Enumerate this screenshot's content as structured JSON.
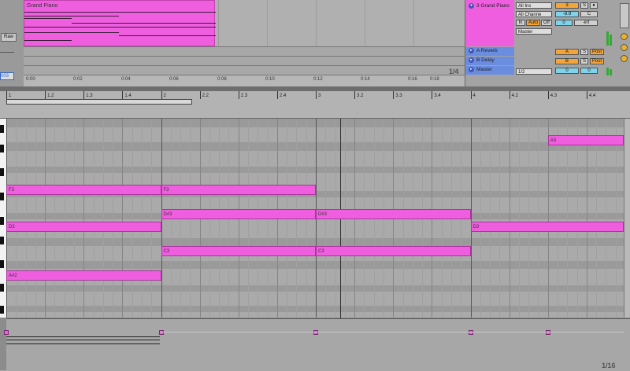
{
  "left_panel": {
    "raw_label": "Raw",
    "bottom_value": "003"
  },
  "arrangement": {
    "clip_name": "Grand Piano",
    "time_labels": [
      "0:00",
      "0:02",
      "0:04",
      "0:06",
      "0:08",
      "0:10",
      "0:12",
      "0:14",
      "0:16",
      "0:18"
    ],
    "zoom_label": "1/4"
  },
  "mixer": {
    "tracks": [
      {
        "name": "3 Grand Piano",
        "input": "All Ins",
        "channel": "All Channe",
        "monitor": [
          "In",
          "Auto",
          "Off"
        ],
        "output": "Master",
        "track_number": "3",
        "solo": "S",
        "volume": "-8.9",
        "pan": "C",
        "send_a": "0",
        "send_b": "-inf"
      },
      {
        "name": "A Reverb",
        "track_number": "A",
        "solo": "S",
        "post": "Post"
      },
      {
        "name": "B Delay",
        "track_number": "B",
        "solo": "S",
        "post": "Post"
      },
      {
        "name": "Master",
        "output": "1/2",
        "track_number": "0",
        "solo": "0"
      }
    ],
    "colors": {
      "clip": "#f05ee0",
      "return": "#6b8de0",
      "orange": "#f3a53a",
      "cyan": "#7fd3ea"
    }
  },
  "midi_editor": {
    "ruler_labels": [
      "1",
      "1.2",
      "1.3",
      "1.4",
      "2",
      "2.2",
      "2.3",
      "2.4",
      "3",
      "3.2",
      "3.3",
      "3.4",
      "4",
      "4.2",
      "4.3",
      "4.4"
    ],
    "notes": [
      {
        "pitch": "A3",
        "start_beat": 4.5,
        "length_beats": 0.5
      },
      {
        "pitch": "F3",
        "start_beat": 1.0,
        "length_beats": 1.0
      },
      {
        "pitch": "F3",
        "start_beat": 2.0,
        "length_beats": 1.0
      },
      {
        "pitch": "D#3",
        "start_beat": 2.0,
        "length_beats": 1.0
      },
      {
        "pitch": "D#3",
        "start_beat": 3.0,
        "length_beats": 1.0
      },
      {
        "pitch": "D3",
        "start_beat": 1.0,
        "length_beats": 1.0
      },
      {
        "pitch": "D3",
        "start_beat": 4.0,
        "length_beats": 1.0
      },
      {
        "pitch": "C3",
        "start_beat": 2.0,
        "length_beats": 1.0
      },
      {
        "pitch": "C3",
        "start_beat": 3.0,
        "length_beats": 1.0
      },
      {
        "pitch": "A#2",
        "start_beat": 1.0,
        "length_beats": 1.0
      }
    ],
    "zoom_label": "1/16"
  }
}
